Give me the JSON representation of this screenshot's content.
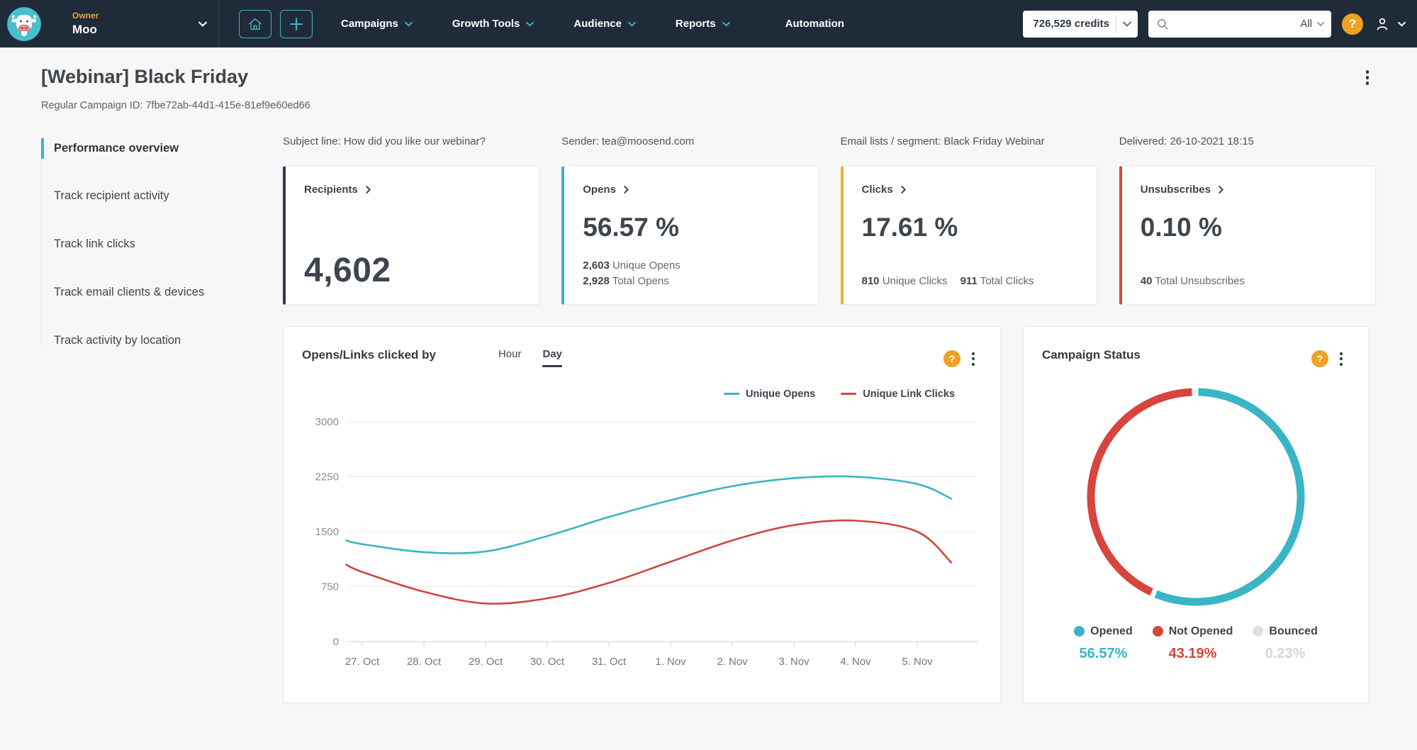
{
  "navbar": {
    "owner_label": "Owner",
    "owner_name": "Moo",
    "menu": [
      {
        "label": "Campaigns",
        "chevron": true
      },
      {
        "label": "Growth Tools",
        "chevron": true
      },
      {
        "label": "Audience",
        "chevron": true
      },
      {
        "label": "Reports",
        "chevron": true
      },
      {
        "label": "Automation",
        "chevron": false
      }
    ],
    "credits": "726,529 credits",
    "search": {
      "value": "",
      "scope": "All"
    },
    "help_glyph": "?"
  },
  "header": {
    "title": "[Webinar] Black Friday",
    "campaign_id": "Regular Campaign ID: 7fbe72ab-44d1-415e-81ef9e60ed66"
  },
  "sidebar": {
    "items": [
      {
        "label": "Performance overview",
        "active": true
      },
      {
        "label": "Track recipient activity",
        "active": false
      },
      {
        "label": "Track link clicks",
        "active": false
      },
      {
        "label": "Track email clients & devices",
        "active": false
      },
      {
        "label": "Track activity by location",
        "active": false
      }
    ]
  },
  "info": {
    "subject": "Subject line: How did you like our webinar?",
    "sender": "Sender: tea@moosend.com",
    "lists": "Email lists / segment: Black Friday Webinar",
    "delivered": "Delivered: 26-10-2021 18:15"
  },
  "stats": {
    "recipients": {
      "label": "Recipients",
      "value": "4,602",
      "accent": "#2c3a52"
    },
    "opens": {
      "label": "Opens",
      "value": "56.57 %",
      "unique": "2,603",
      "unique_label": "Unique Opens",
      "total": "2,928",
      "total_label": "Total Opens",
      "accent": "#3ab5c5"
    },
    "clicks": {
      "label": "Clicks",
      "value": "17.61 %",
      "unique": "810",
      "unique_label": "Unique Clicks",
      "total": "911",
      "total_label": "Total Clicks",
      "accent": "#edb22f"
    },
    "unsubscribes": {
      "label": "Unsubscribes",
      "value": "0.10 %",
      "total": "40",
      "total_label": "Total Unsubscribes",
      "accent": "#d8453e"
    }
  },
  "chart_data": [
    {
      "type": "line",
      "title": "Opens/Links clicked by",
      "toggle": {
        "options": [
          "Hour",
          "Day"
        ],
        "selected": "Day"
      },
      "categories": [
        "27. Oct",
        "28. Oct",
        "29. Oct",
        "30. Oct",
        "31. Oct",
        "1. Nov",
        "2. Nov",
        "3. Nov",
        "4. Nov",
        "5. Nov"
      ],
      "x_positions": [
        -0.26,
        0,
        1,
        2,
        3,
        4,
        5,
        6,
        7,
        8,
        9,
        9.55
      ],
      "series": [
        {
          "name": "Unique Opens",
          "color": "#3ab5c5",
          "values": [
            1380,
            1330,
            1220,
            1230,
            1440,
            1700,
            1930,
            2120,
            2230,
            2250,
            2150,
            1950
          ]
        },
        {
          "name": "Unique Link Clicks",
          "color": "#cf4540",
          "values": [
            1050,
            950,
            680,
            520,
            590,
            800,
            1090,
            1380,
            1590,
            1650,
            1500,
            1080
          ]
        }
      ],
      "ylim": [
        0,
        3000
      ],
      "yticks": [
        0,
        750,
        1500,
        2250,
        3000
      ],
      "grid": true,
      "legend_position": "top-right"
    },
    {
      "type": "donut",
      "title": "Campaign Status",
      "slices": [
        {
          "label": "Opened",
          "value": 56.57,
          "percent_label": "56.57%",
          "color": "#3ab5c5",
          "text_color": "#3ab5c5"
        },
        {
          "label": "Not Opened",
          "value": 43.19,
          "percent_label": "43.19%",
          "color": "#d8453e",
          "text_color": "#d8453e"
        },
        {
          "label": "Bounced",
          "value": 0.23,
          "percent_label": "0.23%",
          "color": "#e0e0e0",
          "text_color": "#d6d6d6"
        }
      ],
      "legend_position": "bottom"
    }
  ]
}
